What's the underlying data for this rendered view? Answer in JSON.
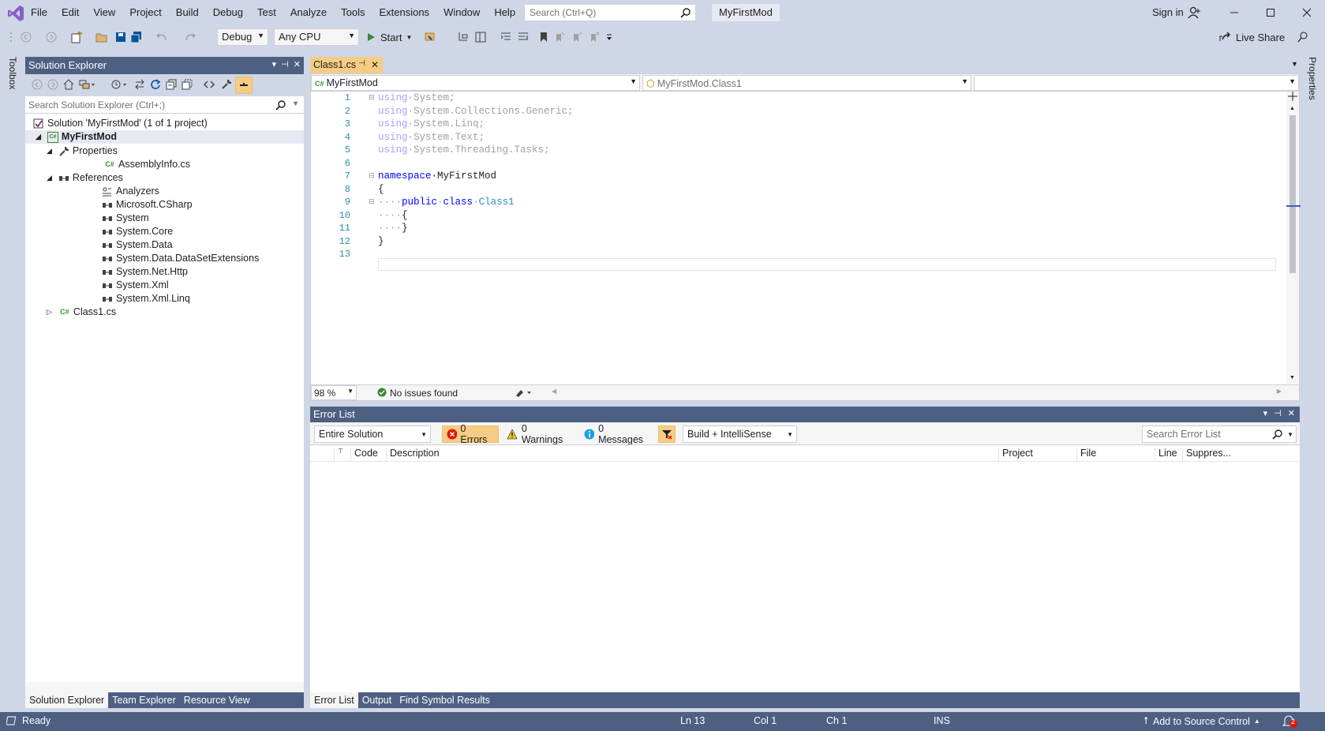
{
  "window": {
    "menu": [
      "File",
      "Edit",
      "View",
      "Project",
      "Build",
      "Debug",
      "Test",
      "Analyze",
      "Tools",
      "Extensions",
      "Window",
      "Help"
    ],
    "search_placeholder": "Search (Ctrl+Q)",
    "project_name": "MyFirstMod",
    "sign_in": "Sign in"
  },
  "toolbar": {
    "config": "Debug",
    "platform": "Any CPU",
    "start": "Start",
    "live_share": "Live Share"
  },
  "side_tabs": {
    "toolbox": "Toolbox",
    "properties": "Properties"
  },
  "solution_explorer": {
    "title": "Solution Explorer",
    "search_placeholder": "Search Solution Explorer (Ctrl+;)",
    "tree": {
      "solution": "Solution 'MyFirstMod' (1 of 1 project)",
      "project": "MyFirstMod",
      "properties": "Properties",
      "assembly_info": "AssemblyInfo.cs",
      "references": "References",
      "refs": [
        "Analyzers",
        "Microsoft.CSharp",
        "System",
        "System.Core",
        "System.Data",
        "System.Data.DataSetExtensions",
        "System.Net.Http",
        "System.Xml",
        "System.Xml.Linq"
      ],
      "class_file": "Class1.cs"
    },
    "tabs": [
      "Solution Explorer",
      "Team Explorer",
      "Resource View"
    ]
  },
  "editor": {
    "tab": "Class1.cs",
    "nav_project": "MyFirstMod",
    "nav_class": "MyFirstMod.Class1",
    "line_numbers": [
      "1",
      "2",
      "3",
      "4",
      "5",
      "6",
      "7",
      "8",
      "9",
      "10",
      "11",
      "12",
      "13"
    ],
    "code": {
      "l1_kw": "using",
      "l1_rest": "·System;",
      "l2_kw": "using",
      "l2_rest": "·System.Collections.Generic;",
      "l3_kw": "using",
      "l3_rest": "·System.Linq;",
      "l4_kw": "using",
      "l4_rest": "·System.Text;",
      "l5_kw": "using",
      "l5_rest": "·System.Threading.Tasks;",
      "l7_kw": "namespace",
      "l7_rest": "·MyFirstMod",
      "l8": "{",
      "l9_dots": "····",
      "l9_kw1": "public",
      "l9_sp": "·",
      "l9_kw2": "class",
      "l9_sp2": "·",
      "l9_ty": "Class1",
      "l10_dots": "····",
      "l10": "{",
      "l11_dots": "····",
      "l11": "}",
      "l12": "}"
    },
    "zoom": "98 %",
    "issues": "No issues found"
  },
  "error_list": {
    "title": "Error List",
    "scope": "Entire Solution",
    "errors": "0 Errors",
    "warnings": "0 Warnings",
    "messages": "0 Messages",
    "build_filter": "Build + IntelliSense",
    "search_placeholder": "Search Error List",
    "columns": [
      "Code",
      "Description",
      "Project",
      "File",
      "Line",
      "Suppres..."
    ],
    "tabs": [
      "Error List",
      "Output",
      "Find Symbol Results"
    ]
  },
  "status": {
    "ready": "Ready",
    "ln": "Ln 13",
    "col": "Col 1",
    "ch": "Ch 1",
    "ins": "INS",
    "source_control": "Add to Source Control",
    "notifications": "2"
  },
  "colors": {
    "accent": "#4d6082",
    "tab_active": "#f5cc84",
    "vs_purple": "#68217a"
  }
}
